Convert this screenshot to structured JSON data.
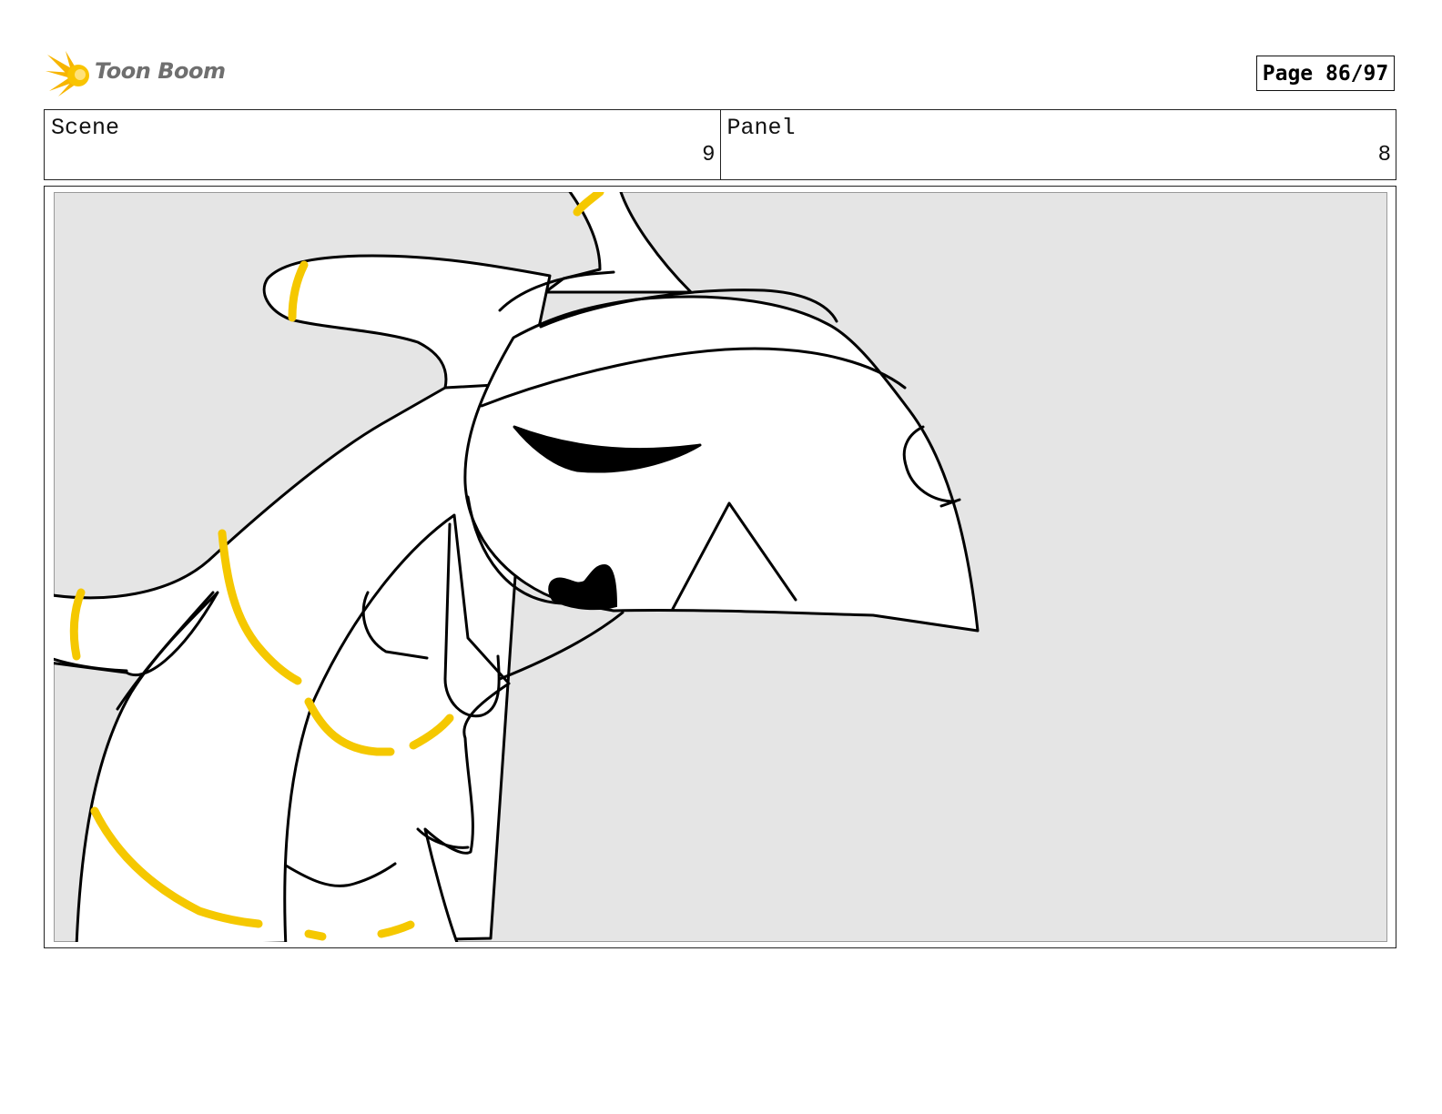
{
  "header": {
    "logo_text": "Toon Boom",
    "page_indicator": "Page 86/97"
  },
  "info": {
    "scene_label": "Scene",
    "scene_value": "9",
    "panel_label": "Panel",
    "panel_value": "8"
  },
  "colors": {
    "background_fill": "#e5e5e5",
    "character_fill": "#ffffff",
    "accent_yellow": "#f5c800",
    "ink": "#000000"
  }
}
